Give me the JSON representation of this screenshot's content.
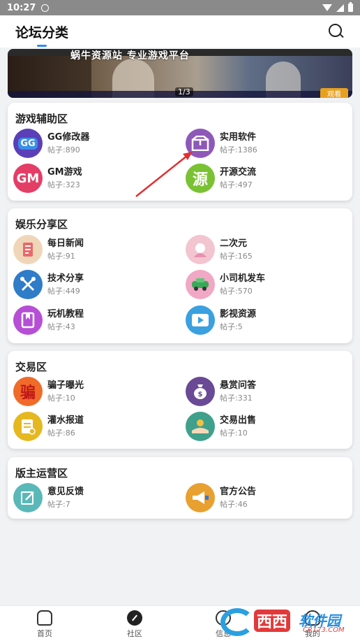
{
  "status_bar": {
    "time": "10:27"
  },
  "header": {
    "title": "论坛分类"
  },
  "banner": {
    "headline": "蜗牛资源站 专业游戏平台",
    "indicator": "1/3",
    "badge": "观看"
  },
  "sections": [
    {
      "title": "游戏辅助区",
      "items": [
        {
          "name": "GG修改器",
          "count": "帖子:890",
          "icon": "gg-modifier-icon",
          "color": "#5a3fb8"
        },
        {
          "name": "实用软件",
          "count": "帖子:1386",
          "icon": "box-icon",
          "color": "#8e58b8"
        },
        {
          "name": "GM游戏",
          "count": "帖子:323",
          "icon": "gm-icon",
          "color": "#e43e66"
        },
        {
          "name": "开源交流",
          "count": "帖子:497",
          "icon": "source-icon",
          "color": "#7ac234"
        }
      ]
    },
    {
      "title": "娱乐分享区",
      "items": [
        {
          "name": "每日新闻",
          "count": "帖子:91",
          "icon": "news-icon",
          "color": "#f0d6b8"
        },
        {
          "name": "二次元",
          "count": "帖子:165",
          "icon": "anime-icon",
          "color": "#f3c5d0"
        },
        {
          "name": "技术分享",
          "count": "帖子:449",
          "icon": "tools-icon",
          "color": "#2f7cc8"
        },
        {
          "name": "小司机发车",
          "count": "帖子:570",
          "icon": "driver-icon",
          "color": "#f0a8c4"
        },
        {
          "name": "玩机教程",
          "count": "帖子:43",
          "icon": "book-icon",
          "color": "#b64fd6"
        },
        {
          "name": "影视资源",
          "count": "帖子:5",
          "icon": "video-icon",
          "color": "#3aa0e0"
        }
      ]
    },
    {
      "title": "交易区",
      "items": [
        {
          "name": "骗子曝光",
          "count": "帖子:10",
          "icon": "scam-icon",
          "color": "#f06b2a"
        },
        {
          "name": "悬赏问答",
          "count": "帖子:331",
          "icon": "money-bag-icon",
          "color": "#6a4a96"
        },
        {
          "name": "灌水报道",
          "count": "帖子:86",
          "icon": "note-icon",
          "color": "#e6b820"
        },
        {
          "name": "交易出售",
          "count": "帖子:10",
          "icon": "handshake-icon",
          "color": "#3fa08c"
        }
      ]
    },
    {
      "title": "版主运营区",
      "items": [
        {
          "name": "意见反馈",
          "count": "帖子:7",
          "icon": "feedback-icon",
          "color": "#5ab8b8"
        },
        {
          "name": "官方公告",
          "count": "帖子:46",
          "icon": "megaphone-icon",
          "color": "#e8a030"
        }
      ]
    }
  ],
  "icon_glyphs": {
    "gg": "GG",
    "gm": "GM",
    "source": "源",
    "scam": "骗"
  },
  "tabbar": [
    {
      "label": "首页"
    },
    {
      "label": "社区"
    },
    {
      "label": "信息"
    },
    {
      "label": "我的"
    }
  ],
  "watermark": {
    "text1": "西西",
    "text2": "软件园",
    "sub": "CR173.COM"
  }
}
